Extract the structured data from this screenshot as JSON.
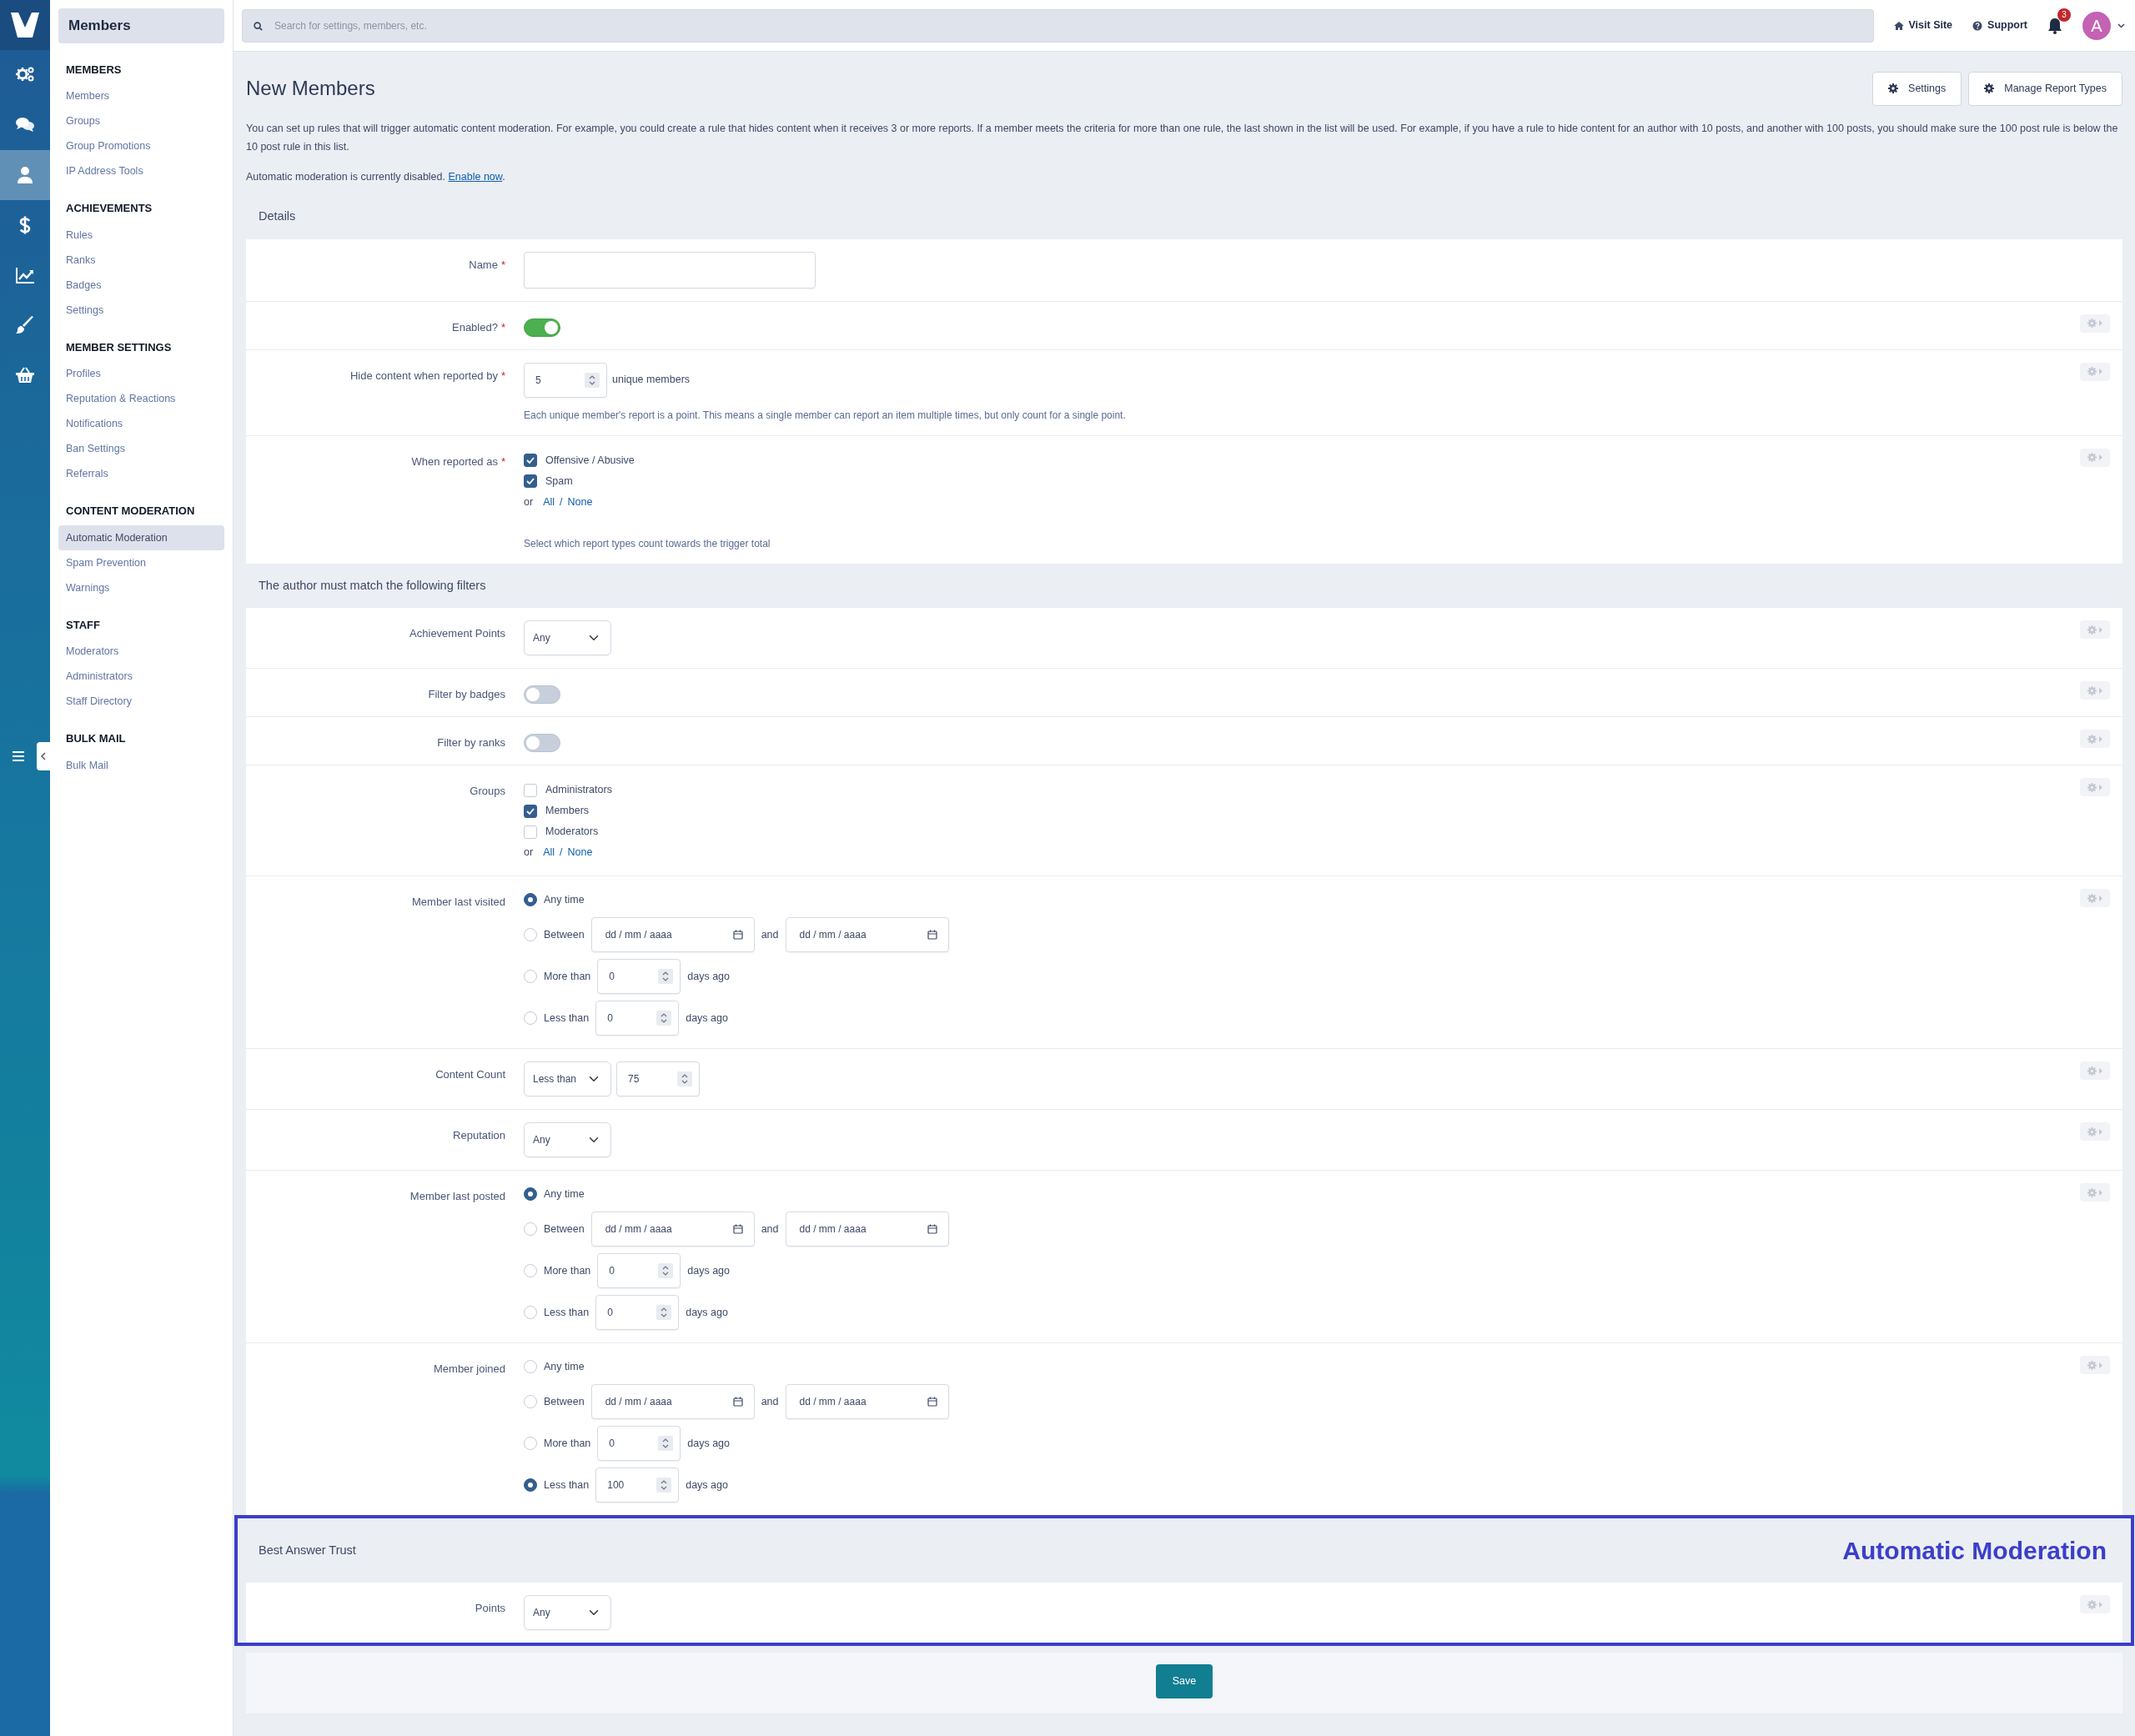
{
  "rail": [
    {
      "selected": false
    },
    {
      "selected": false
    },
    {
      "selected": true
    },
    {
      "selected": false
    },
    {
      "selected": false
    },
    {
      "selected": false
    },
    {
      "selected": false
    }
  ],
  "sidebar": {
    "title": "Members",
    "sections": [
      {
        "heading": "MEMBERS",
        "items": [
          {
            "label": "Members",
            "selected": false
          },
          {
            "label": "Groups",
            "selected": false
          },
          {
            "label": "Group Promotions",
            "selected": false
          },
          {
            "label": "IP Address Tools",
            "selected": false
          }
        ]
      },
      {
        "heading": "ACHIEVEMENTS",
        "items": [
          {
            "label": "Rules",
            "selected": false
          },
          {
            "label": "Ranks",
            "selected": false
          },
          {
            "label": "Badges",
            "selected": false
          },
          {
            "label": "Settings",
            "selected": false
          }
        ]
      },
      {
        "heading": "MEMBER SETTINGS",
        "items": [
          {
            "label": "Profiles",
            "selected": false
          },
          {
            "label": "Reputation & Reactions",
            "selected": false
          },
          {
            "label": "Notifications",
            "selected": false
          },
          {
            "label": "Ban Settings",
            "selected": false
          },
          {
            "label": "Referrals",
            "selected": false
          }
        ]
      },
      {
        "heading": "CONTENT MODERATION",
        "items": [
          {
            "label": "Automatic Moderation",
            "selected": true
          },
          {
            "label": "Spam Prevention",
            "selected": false
          },
          {
            "label": "Warnings",
            "selected": false
          }
        ]
      },
      {
        "heading": "STAFF",
        "items": [
          {
            "label": "Moderators",
            "selected": false
          },
          {
            "label": "Administrators",
            "selected": false
          },
          {
            "label": "Staff Directory",
            "selected": false
          }
        ]
      },
      {
        "heading": "BULK MAIL",
        "items": [
          {
            "label": "Bulk Mail",
            "selected": false
          }
        ]
      }
    ]
  },
  "topbar": {
    "search_placeholder": "Search for settings, members, etc.",
    "links": [
      "Visit Site",
      "Support"
    ],
    "notification_count": "3",
    "avatar_letter": "A"
  },
  "page": {
    "title": "New Members",
    "buttons": [
      "Settings",
      "Manage Report Types"
    ],
    "intro": "You can set up rules that will trigger automatic content moderation. For example, you could create a rule that hides content when it receives 3 or more reports. If a member meets the criteria for more than one rule, the last shown in the list will be used. For example, if you have a rule to hide content for an author with 10 posts, and another with 100 posts, you should make sure the 100 post rule is below the 10 post rule in this list.",
    "notice": {
      "text": "Automatic moderation is currently disabled.",
      "link": "Enable now",
      "end": "."
    }
  },
  "sections": [
    {
      "title": "Details",
      "rows": [
        {
          "kind": "text",
          "label": "Name",
          "required_mark": "*",
          "has_options": false
        },
        {
          "kind": "toggle",
          "label": "Enabled?",
          "required_mark": "*",
          "on": true,
          "has_options": true
        },
        {
          "kind": "number",
          "label": "Hide content when reported by",
          "required_mark": "*",
          "value": "5",
          "suffix": "unique members",
          "help": "Each unique member's report is a point. This means a single member can report an item multiple times, but only count for a single point.",
          "has_options": true
        },
        {
          "kind": "checklist",
          "label": "When reported as",
          "required_mark": "*",
          "options": [
            {
              "label": "Offensive / Abusive",
              "checked": true
            },
            {
              "label": "Spam",
              "checked": true
            }
          ],
          "bulk": {
            "or": "or",
            "all": "All",
            "sep": "/",
            "none": "None"
          },
          "help": "Select which report types count towards the trigger total",
          "has_options": true
        }
      ]
    },
    {
      "title": "The author must match the following filters",
      "rows": [
        {
          "kind": "select",
          "label": "Achievement Points",
          "value": "Any",
          "has_options": true
        },
        {
          "kind": "toggle",
          "label": "Filter by badges",
          "on": false,
          "has_options": true
        },
        {
          "kind": "toggle",
          "label": "Filter by ranks",
          "on": false,
          "has_options": true
        },
        {
          "kind": "checklist",
          "label": "Groups",
          "options": [
            {
              "label": "Administrators",
              "checked": false
            },
            {
              "label": "Members",
              "checked": true
            },
            {
              "label": "Moderators",
              "checked": false
            }
          ],
          "bulk": {
            "or": "or",
            "all": "All",
            "sep": "/",
            "none": "None"
          },
          "has_options": true
        },
        {
          "kind": "dates",
          "label": "Member last visited",
          "has_options": true,
          "options": [
            {
              "kind": "any",
              "label": "Any time",
              "selected": true
            },
            {
              "kind": "between",
              "label": "Between",
              "from": {
                "placeholder": "dd / mm / aaaa"
              },
              "and": "and",
              "to": {
                "placeholder": "dd / mm / aaaa"
              },
              "selected": false
            },
            {
              "kind": "days",
              "label": "More than",
              "value": "0",
              "suffix": "days ago",
              "selected": false
            },
            {
              "kind": "days",
              "label": "Less than",
              "value": "0",
              "suffix": "days ago",
              "selected": false
            }
          ]
        },
        {
          "kind": "select_number",
          "label": "Content Count",
          "value": "Less than",
          "number": "75",
          "has_options": true
        },
        {
          "kind": "select",
          "label": "Reputation",
          "value": "Any",
          "has_options": true
        },
        {
          "kind": "dates",
          "label": "Member last posted",
          "has_options": true,
          "options": [
            {
              "kind": "any",
              "label": "Any time",
              "selected": true
            },
            {
              "kind": "between",
              "label": "Between",
              "from": {
                "placeholder": "dd / mm / aaaa"
              },
              "and": "and",
              "to": {
                "placeholder": "dd / mm / aaaa"
              },
              "selected": false
            },
            {
              "kind": "days",
              "label": "More than",
              "value": "0",
              "suffix": "days ago",
              "selected": false
            },
            {
              "kind": "days",
              "label": "Less than",
              "value": "0",
              "suffix": "days ago",
              "selected": false
            }
          ]
        },
        {
          "kind": "dates",
          "label": "Member joined",
          "has_options": true,
          "options": [
            {
              "kind": "any",
              "label": "Any time",
              "selected": false
            },
            {
              "kind": "between",
              "label": "Between",
              "from": {
                "placeholder": "dd / mm / aaaa"
              },
              "and": "and",
              "to": {
                "placeholder": "dd / mm / aaaa"
              },
              "selected": false
            },
            {
              "kind": "days",
              "label": "More than",
              "value": "0",
              "suffix": "days ago",
              "selected": false
            },
            {
              "kind": "days",
              "label": "Less than",
              "value": "100",
              "suffix": "days ago",
              "selected": true
            }
          ]
        }
      ]
    },
    {
      "title": "Best Answer Trust",
      "highlight": "Automatic Moderation",
      "rows": [
        {
          "kind": "select",
          "label": "Points",
          "value": "Any",
          "has_options": true
        }
      ]
    }
  ],
  "save_button": "Save"
}
